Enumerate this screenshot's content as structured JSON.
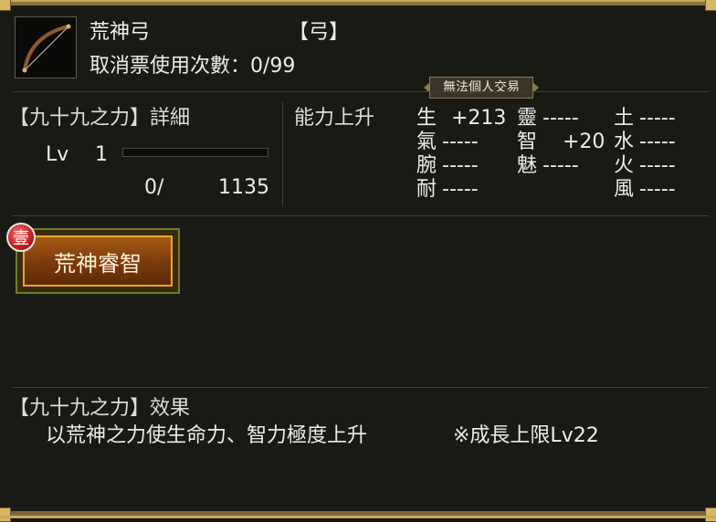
{
  "item": {
    "name": "荒神弓",
    "type_tag": "【弓】",
    "ticket_uses_label": "取消票使用次數：0/99",
    "trade_badge": "無法個人交易"
  },
  "detail": {
    "title": "【九十九之力】詳細",
    "lv_label": "Lv",
    "lv_value": "1",
    "exp_current": "0/",
    "exp_max": "1135",
    "exp_progress_percent": 0
  },
  "abilities": {
    "label": "能力上升",
    "rows": [
      [
        "生",
        "+213"
      ],
      [
        "氣",
        "-----"
      ],
      [
        "腕",
        "-----"
      ],
      [
        "耐",
        "-----"
      ],
      [
        "靈",
        "-----"
      ],
      [
        "智",
        "+20"
      ],
      [
        "魅",
        "-----"
      ],
      [
        "土",
        "-----"
      ],
      [
        "水",
        "-----"
      ],
      [
        "火",
        "-----"
      ],
      [
        "風",
        "-----"
      ]
    ]
  },
  "skill": {
    "badge": "壹",
    "label": "荒神睿智"
  },
  "effect": {
    "title": "【九十九之力】效果",
    "description": "以荒神之力使生命力、智力極度上升",
    "growth_limit": "※成長上限Lv22"
  },
  "colors": {
    "accent_gold": "#c9a95a",
    "skill_orange": "#e6a52d",
    "badge_red": "#b31414"
  },
  "icons": {
    "item_icon": "bow-icon",
    "skill_badge": "number-badge-icon"
  }
}
